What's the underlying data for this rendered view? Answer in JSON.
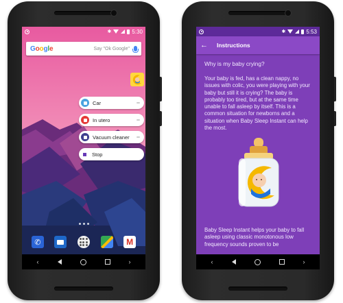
{
  "left_phone": {
    "status": {
      "time": "5:30"
    },
    "search_bar": {
      "logo": "Google",
      "hint": "Say \"Ok Google\""
    },
    "shortcuts": [
      {
        "label": "Car",
        "icon": "car-icon",
        "color": "#4aa3df"
      },
      {
        "label": "In utero",
        "icon": "womb-icon",
        "color": "#e53935"
      },
      {
        "label": "Vacuum cleaner",
        "icon": "vacuum-icon",
        "color": "#3f3f8f"
      },
      {
        "label": "Stop",
        "icon": "stop-icon",
        "color": "#673ab7"
      }
    ],
    "dock": [
      "phone-icon",
      "messages-icon",
      "app-drawer-icon",
      "maps-icon",
      "gmail-icon"
    ]
  },
  "right_phone": {
    "status": {
      "time": "5:53"
    },
    "toolbar": {
      "title": "Instructions"
    },
    "question": "Why is my baby crying?",
    "paragraph1": "Your baby is fed, has a clean nappy, no issues with colic, you were playing with your baby but still it is crying? The baby is probably too tired, but at the same time unable to fall asleep by itself. This is a common situation for newborns and a situation when Baby Sleep Instant can help the most.",
    "paragraph2": "Baby Sleep Instant helps your baby to fall asleep using classic monotonous low frequency sounds proven to be",
    "accent": "#7e3fb8"
  }
}
